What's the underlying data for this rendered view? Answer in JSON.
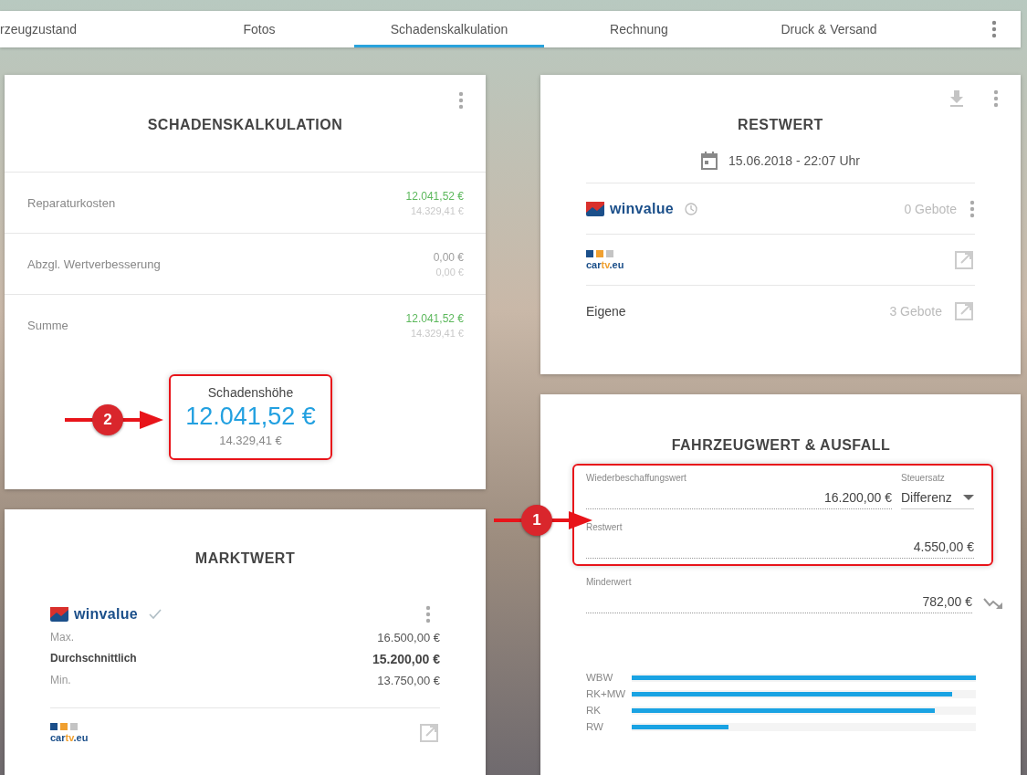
{
  "tabs": [
    {
      "label": "rzeugzustand",
      "selected": false
    },
    {
      "label": "Fotos",
      "selected": false
    },
    {
      "label": "Schadenskalkulation",
      "selected": true
    },
    {
      "label": "Rechnung",
      "selected": false
    },
    {
      "label": "Druck & Versand",
      "selected": false
    }
  ],
  "schadenskalkulation": {
    "title": "SCHADENSKALKULATION",
    "rows": [
      {
        "label": "Reparaturkosten",
        "value": "12.041,52 €",
        "color": "#5cb85c",
        "secondary": "14.329,41 €"
      },
      {
        "label": "Abzgl. Wertverbesserung",
        "value": "0,00 €",
        "color": "#9e9e9e",
        "secondary": "0,00 €"
      },
      {
        "label": "Summe",
        "value": "12.041,52 €",
        "color": "#5cb85c",
        "secondary": "14.329,41 €"
      }
    ],
    "total": {
      "label": "Schadenshöhe",
      "value": "12.041,52 €",
      "secondary": "14.329,41 €",
      "annotation": "2"
    }
  },
  "marktwert": {
    "title": "MARKTWERT",
    "provider_logo": "winvalue",
    "rows": [
      {
        "label": "Max.",
        "value": "16.500,00 €",
        "emphasized": false
      },
      {
        "label": "Durchschnittlich",
        "value": "15.200,00 €",
        "emphasized": true
      },
      {
        "label": "Min.",
        "value": "13.750,00 €",
        "emphasized": false
      }
    ],
    "link_logo": [
      "car",
      "tv",
      ".eu"
    ]
  },
  "restwert": {
    "title": "RESTWERT",
    "date": "15.06.2018 - 22:07 Uhr",
    "providers": [
      {
        "kind": "winvalue",
        "logo": "winvalue",
        "bids": "0 Gebote"
      },
      {
        "kind": "cartv",
        "logo_parts": [
          "car",
          "tv",
          ".eu"
        ]
      },
      {
        "kind": "own",
        "label": "Eigene",
        "bids": "3 Gebote"
      }
    ]
  },
  "fahrzeugwert": {
    "title": "FAHRZEUGWERT & AUSFALL",
    "annotation": "1",
    "wbw": {
      "label": "Wiederbeschaffungswert",
      "value": "16.200,00 €"
    },
    "steuersatz": {
      "label": "Steuersatz",
      "value": "Differenz"
    },
    "restwert": {
      "label": "Restwert",
      "value": "4.550,00 €"
    },
    "minderwert": {
      "label": "Minderwert",
      "value": "782,00 €"
    },
    "bars": [
      {
        "label": "WBW",
        "level": 1
      },
      {
        "label": "RK+MW",
        "level": 0.93
      },
      {
        "label": "RK",
        "level": 0.88
      },
      {
        "label": "RW",
        "level": 0.28
      }
    ]
  }
}
